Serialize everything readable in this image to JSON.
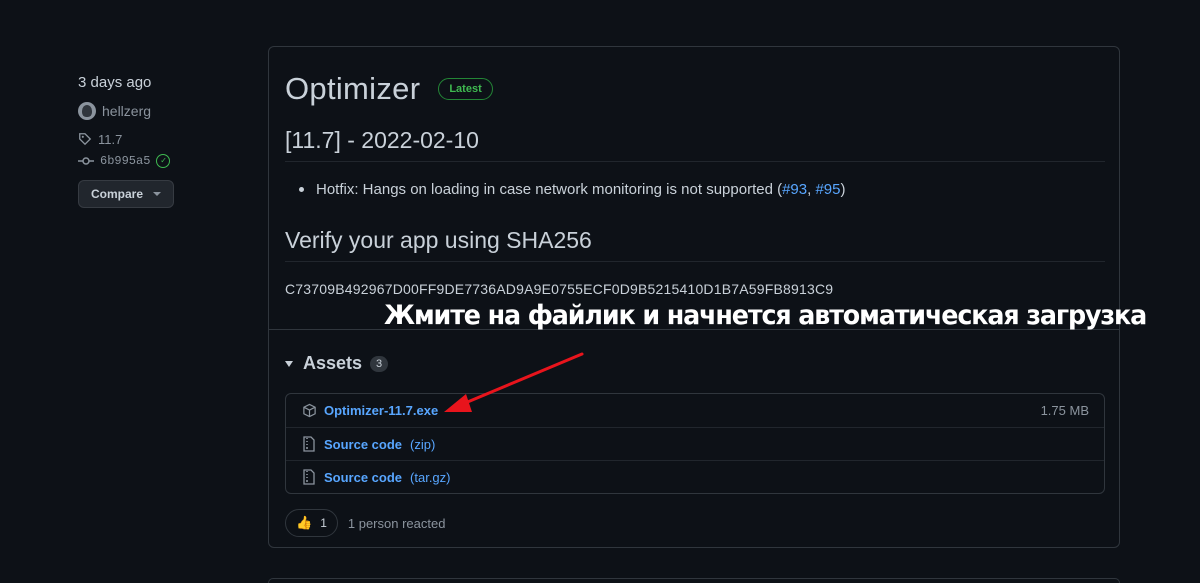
{
  "meta": {
    "date": "3 days ago",
    "author": "hellzerg",
    "tag": "11.7",
    "commit": "6b995a5",
    "compare_label": "Compare"
  },
  "release": {
    "title": "Optimizer",
    "badge": "Latest",
    "version_heading": "[11.7] - 2022-02-10",
    "bullet": {
      "text": "Hotfix: Hangs on loading in case network monitoring is not supported (",
      "link1": "#93",
      "sep": ", ",
      "link2": "#95",
      "close": ")"
    },
    "verify_heading": "Verify your app using SHA256",
    "hash": "C73709B492967D00FF9DE7736AD9A9E0755ECF0D9B5215410D1B7A59FB8913C9"
  },
  "assets": {
    "label": "Assets",
    "count": "3",
    "items": [
      {
        "name": "Optimizer-11.7.exe",
        "ext": "",
        "size": "1.75 MB",
        "icon": "package-icon"
      },
      {
        "name": "Source code",
        "ext": "(zip)",
        "size": "",
        "icon": "file-zip-icon"
      },
      {
        "name": "Source code",
        "ext": "(tar.gz)",
        "size": "",
        "icon": "file-zip-icon"
      }
    ]
  },
  "reactions": {
    "emoji": "👍",
    "count": "1",
    "text": "1 person reacted"
  },
  "annotation": {
    "caption": "Жмите на файлик и начнется автоматическая загрузка",
    "arrow_color": "#e8141c"
  }
}
